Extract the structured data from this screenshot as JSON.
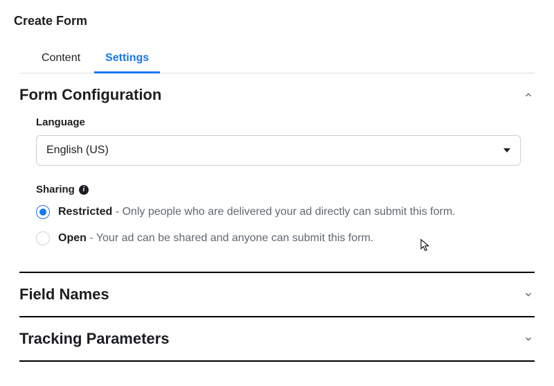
{
  "page_title": "Create Form",
  "tabs": [
    {
      "label": "Content",
      "active": false
    },
    {
      "label": "Settings",
      "active": true
    }
  ],
  "sections": {
    "form_configuration": {
      "title": "Form Configuration",
      "expanded": true,
      "language": {
        "label": "Language",
        "value": "English (US)"
      },
      "sharing": {
        "label": "Sharing",
        "options": [
          {
            "name": "Restricted",
            "desc": " - Only people who are delivered your ad directly can submit this form.",
            "selected": true
          },
          {
            "name": "Open",
            "desc": " - Your ad can be shared and anyone can submit this form.",
            "selected": false
          }
        ]
      }
    },
    "field_names": {
      "title": "Field Names",
      "expanded": false
    },
    "tracking_parameters": {
      "title": "Tracking Parameters",
      "expanded": false
    }
  }
}
